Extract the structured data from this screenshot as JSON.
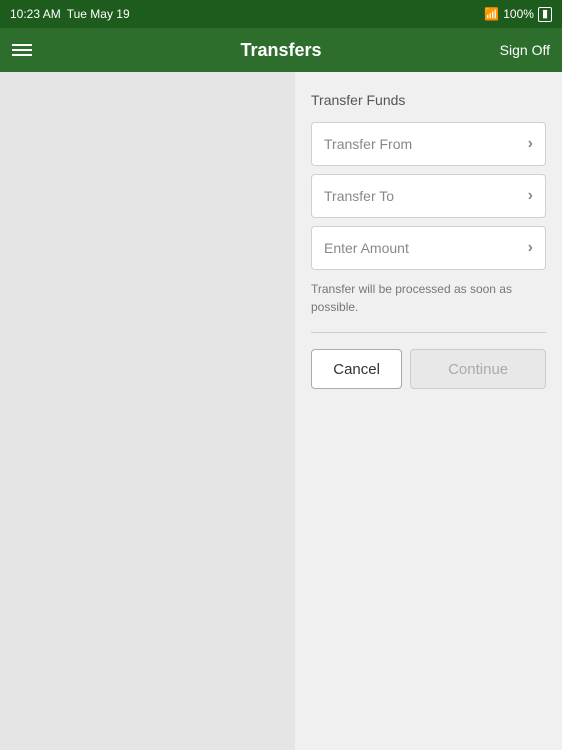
{
  "statusBar": {
    "time": "10:23 AM",
    "date": "Tue May 19",
    "battery": "100%",
    "signal": "wifi"
  },
  "navBar": {
    "title": "Transfers",
    "menuIcon": "menu-icon",
    "signOffLabel": "Sign Off"
  },
  "form": {
    "sectionTitle": "Transfer Funds",
    "transferFromLabel": "Transfer From",
    "transferToLabel": "Transfer To",
    "enterAmountLabel": "Enter Amount",
    "noteText": "Transfer will be processed as soon as possible.",
    "cancelLabel": "Cancel",
    "continueLabel": "Continue"
  }
}
